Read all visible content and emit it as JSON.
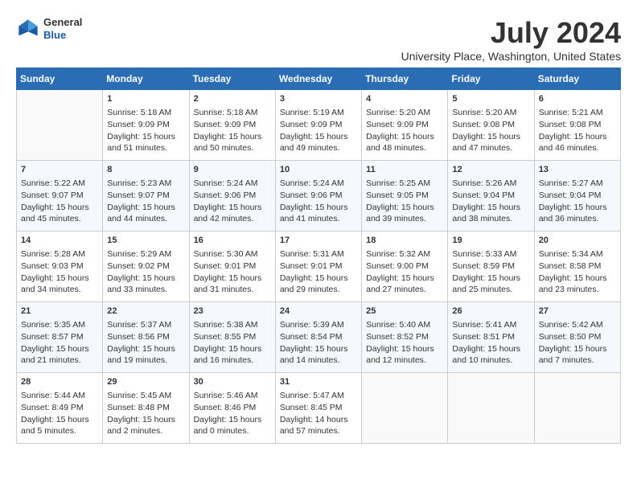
{
  "logo": {
    "general": "General",
    "blue": "Blue"
  },
  "header": {
    "month_year": "July 2024",
    "location": "University Place, Washington, United States"
  },
  "days_of_week": [
    "Sunday",
    "Monday",
    "Tuesday",
    "Wednesday",
    "Thursday",
    "Friday",
    "Saturday"
  ],
  "weeks": [
    [
      {
        "day": "",
        "content": ""
      },
      {
        "day": "1",
        "content": "Sunrise: 5:18 AM\nSunset: 9:09 PM\nDaylight: 15 hours\nand 51 minutes."
      },
      {
        "day": "2",
        "content": "Sunrise: 5:18 AM\nSunset: 9:09 PM\nDaylight: 15 hours\nand 50 minutes."
      },
      {
        "day": "3",
        "content": "Sunrise: 5:19 AM\nSunset: 9:09 PM\nDaylight: 15 hours\nand 49 minutes."
      },
      {
        "day": "4",
        "content": "Sunrise: 5:20 AM\nSunset: 9:09 PM\nDaylight: 15 hours\nand 48 minutes."
      },
      {
        "day": "5",
        "content": "Sunrise: 5:20 AM\nSunset: 9:08 PM\nDaylight: 15 hours\nand 47 minutes."
      },
      {
        "day": "6",
        "content": "Sunrise: 5:21 AM\nSunset: 9:08 PM\nDaylight: 15 hours\nand 46 minutes."
      }
    ],
    [
      {
        "day": "7",
        "content": "Sunrise: 5:22 AM\nSunset: 9:07 PM\nDaylight: 15 hours\nand 45 minutes."
      },
      {
        "day": "8",
        "content": "Sunrise: 5:23 AM\nSunset: 9:07 PM\nDaylight: 15 hours\nand 44 minutes."
      },
      {
        "day": "9",
        "content": "Sunrise: 5:24 AM\nSunset: 9:06 PM\nDaylight: 15 hours\nand 42 minutes."
      },
      {
        "day": "10",
        "content": "Sunrise: 5:24 AM\nSunset: 9:06 PM\nDaylight: 15 hours\nand 41 minutes."
      },
      {
        "day": "11",
        "content": "Sunrise: 5:25 AM\nSunset: 9:05 PM\nDaylight: 15 hours\nand 39 minutes."
      },
      {
        "day": "12",
        "content": "Sunrise: 5:26 AM\nSunset: 9:04 PM\nDaylight: 15 hours\nand 38 minutes."
      },
      {
        "day": "13",
        "content": "Sunrise: 5:27 AM\nSunset: 9:04 PM\nDaylight: 15 hours\nand 36 minutes."
      }
    ],
    [
      {
        "day": "14",
        "content": "Sunrise: 5:28 AM\nSunset: 9:03 PM\nDaylight: 15 hours\nand 34 minutes."
      },
      {
        "day": "15",
        "content": "Sunrise: 5:29 AM\nSunset: 9:02 PM\nDaylight: 15 hours\nand 33 minutes."
      },
      {
        "day": "16",
        "content": "Sunrise: 5:30 AM\nSunset: 9:01 PM\nDaylight: 15 hours\nand 31 minutes."
      },
      {
        "day": "17",
        "content": "Sunrise: 5:31 AM\nSunset: 9:01 PM\nDaylight: 15 hours\nand 29 minutes."
      },
      {
        "day": "18",
        "content": "Sunrise: 5:32 AM\nSunset: 9:00 PM\nDaylight: 15 hours\nand 27 minutes."
      },
      {
        "day": "19",
        "content": "Sunrise: 5:33 AM\nSunset: 8:59 PM\nDaylight: 15 hours\nand 25 minutes."
      },
      {
        "day": "20",
        "content": "Sunrise: 5:34 AM\nSunset: 8:58 PM\nDaylight: 15 hours\nand 23 minutes."
      }
    ],
    [
      {
        "day": "21",
        "content": "Sunrise: 5:35 AM\nSunset: 8:57 PM\nDaylight: 15 hours\nand 21 minutes."
      },
      {
        "day": "22",
        "content": "Sunrise: 5:37 AM\nSunset: 8:56 PM\nDaylight: 15 hours\nand 19 minutes."
      },
      {
        "day": "23",
        "content": "Sunrise: 5:38 AM\nSunset: 8:55 PM\nDaylight: 15 hours\nand 16 minutes."
      },
      {
        "day": "24",
        "content": "Sunrise: 5:39 AM\nSunset: 8:54 PM\nDaylight: 15 hours\nand 14 minutes."
      },
      {
        "day": "25",
        "content": "Sunrise: 5:40 AM\nSunset: 8:52 PM\nDaylight: 15 hours\nand 12 minutes."
      },
      {
        "day": "26",
        "content": "Sunrise: 5:41 AM\nSunset: 8:51 PM\nDaylight: 15 hours\nand 10 minutes."
      },
      {
        "day": "27",
        "content": "Sunrise: 5:42 AM\nSunset: 8:50 PM\nDaylight: 15 hours\nand 7 minutes."
      }
    ],
    [
      {
        "day": "28",
        "content": "Sunrise: 5:44 AM\nSunset: 8:49 PM\nDaylight: 15 hours\nand 5 minutes."
      },
      {
        "day": "29",
        "content": "Sunrise: 5:45 AM\nSunset: 8:48 PM\nDaylight: 15 hours\nand 2 minutes."
      },
      {
        "day": "30",
        "content": "Sunrise: 5:46 AM\nSunset: 8:46 PM\nDaylight: 15 hours\nand 0 minutes."
      },
      {
        "day": "31",
        "content": "Sunrise: 5:47 AM\nSunset: 8:45 PM\nDaylight: 14 hours\nand 57 minutes."
      },
      {
        "day": "",
        "content": ""
      },
      {
        "day": "",
        "content": ""
      },
      {
        "day": "",
        "content": ""
      }
    ]
  ]
}
